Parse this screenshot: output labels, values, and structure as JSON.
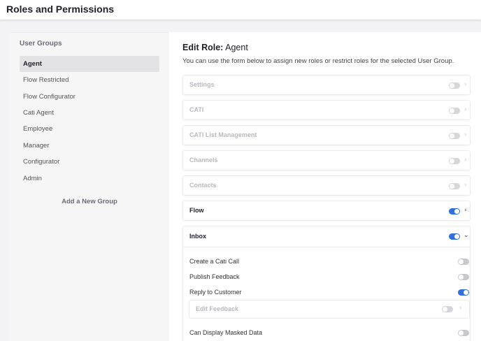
{
  "header": {
    "title": "Roles and Permissions"
  },
  "sidebar": {
    "heading": "User Groups",
    "groups": [
      {
        "label": "Agent",
        "active": true
      },
      {
        "label": "Flow Restricted"
      },
      {
        "label": "Flow Configurator"
      },
      {
        "label": "Cati Agent"
      },
      {
        "label": "Employee"
      },
      {
        "label": "Manager"
      },
      {
        "label": "Configurator"
      },
      {
        "label": "Admin"
      }
    ],
    "add_label": "Add a New Group"
  },
  "main": {
    "title_prefix": "Edit Role:",
    "title_role": "Agent",
    "description": "You can use the form below to assign new roles or restrict roles for the selected User Group.",
    "roles": [
      {
        "label": "Settings",
        "enabled": false
      },
      {
        "label": "CATI",
        "enabled": false
      },
      {
        "label": "CATI List Management",
        "enabled": false
      },
      {
        "label": "Channels",
        "enabled": false
      },
      {
        "label": "Contacts",
        "enabled": false
      },
      {
        "label": "Flow",
        "enabled": true
      }
    ],
    "inbox": {
      "label": "Inbox",
      "enabled": true,
      "permissions": [
        {
          "label": "Create a Cati Call",
          "enabled": false
        },
        {
          "label": "Publish Feedback",
          "enabled": false
        },
        {
          "label": "Reply to Customer",
          "enabled": true
        }
      ],
      "sub_role": {
        "label": "Edit Feedback",
        "enabled": false
      },
      "extra_permission": {
        "label": "Can Display Masked Data",
        "enabled": false
      }
    }
  },
  "colors": {
    "accent": "#2f6fde",
    "toggle_off": "#c8c8cc"
  },
  "icons": {
    "chevron_right": "chevron-right-icon",
    "chevron_down": "chevron-down-icon"
  }
}
